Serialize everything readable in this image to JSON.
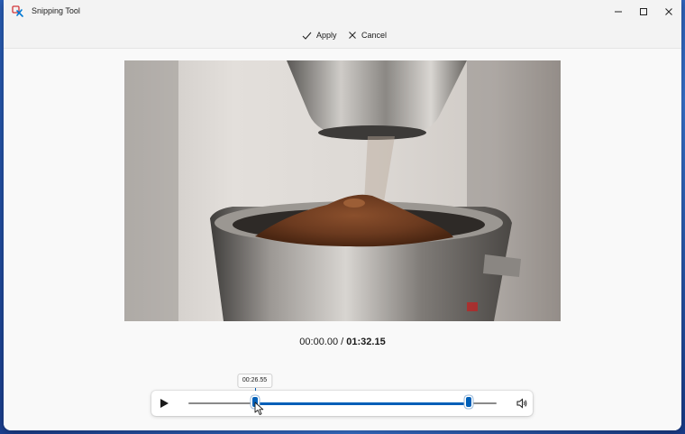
{
  "window": {
    "title": "Snipping Tool",
    "minimize_icon": "minimize-icon",
    "maximize_icon": "maximize-icon",
    "close_icon": "close-icon"
  },
  "toolbar": {
    "apply_label": "Apply",
    "cancel_label": "Cancel"
  },
  "video": {
    "current_time": "00:00.00",
    "separator": " / ",
    "duration": "01:32.15"
  },
  "player": {
    "tooltip_time": "00:26.55",
    "trim_start_fraction": 0.215,
    "trim_end_fraction": 0.91
  },
  "colors": {
    "accent": "#005fb8",
    "track": "#8a8a8a"
  }
}
